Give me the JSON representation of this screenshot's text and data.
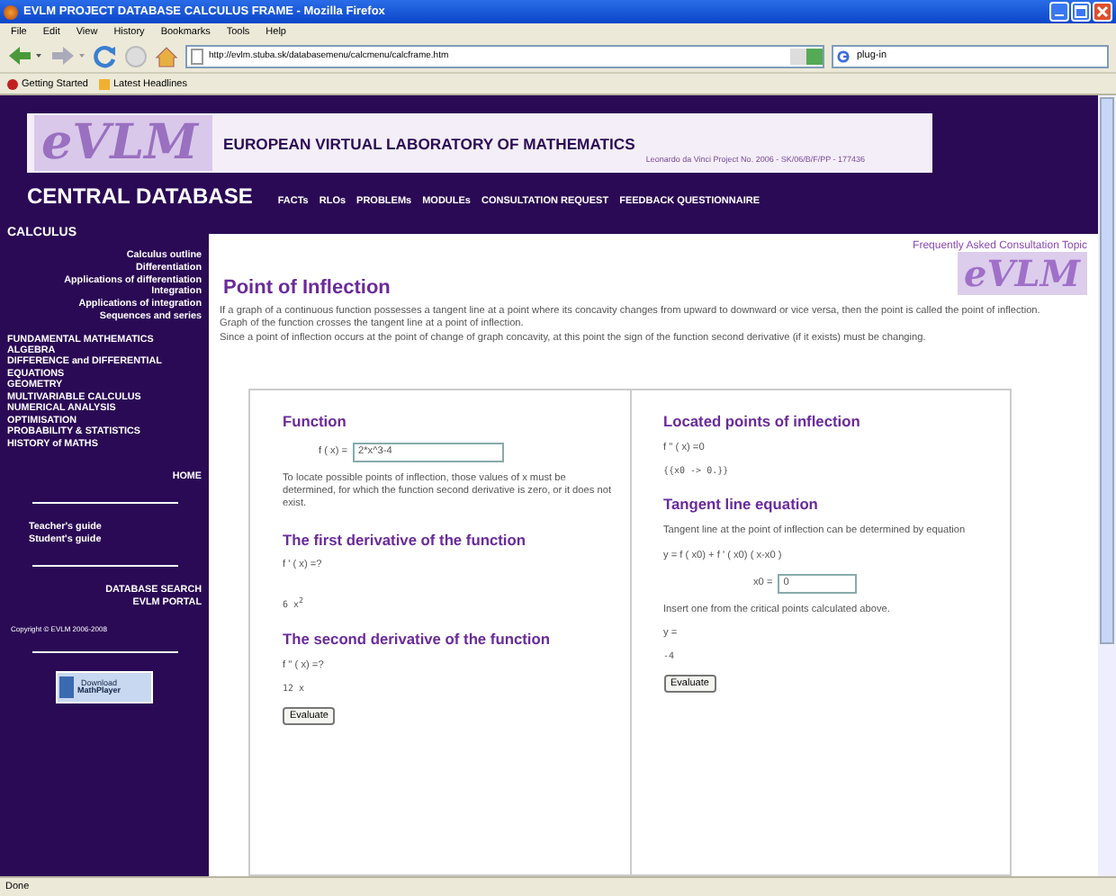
{
  "window": {
    "title": "EVLM PROJECT DATABASE CALCULUS FRAME - Mozilla Firefox"
  },
  "menu": [
    "File",
    "Edit",
    "View",
    "History",
    "Bookmarks",
    "Tools",
    "Help"
  ],
  "address": {
    "value": "http://evlm.stuba.sk/databasemenu/calcmenu/calcframe.htm"
  },
  "search": {
    "value": "plug-in"
  },
  "bookmarks": [
    "Getting Started",
    "Latest Headlines"
  ],
  "header": {
    "logo": "eVLM",
    "title": "EUROPEAN VIRTUAL LABORATORY OF MATHEMATICS",
    "project": "Leonardo da Vinci Project No. 2006 - SK/06/B/F/PP - 177436",
    "site": "CENTRAL DATABASE",
    "nav": [
      "FACTs",
      "RLOs",
      "PROBLEMs",
      "MODULEs",
      "CONSULTATION REQUEST",
      "FEEDBACK QUESTIONNAIRE"
    ]
  },
  "sidebar": {
    "section": "CALCULUS",
    "links": [
      "Calculus outline",
      "Differentiation",
      "Applications of differentiation",
      "Integration",
      "Applications of integration",
      "Sequences and series"
    ],
    "topics": [
      "FUNDAMENTAL MATHEMATICS",
      "ALGEBRA",
      "DIFFERENCE and DIFFERENTIAL EQUATIONS",
      "GEOMETRY",
      "MULTIVARIABLE CALCULUS",
      "NUMERICAL ANALYSIS",
      "OPTIMISATION",
      "PROBABILITY & STATISTICS",
      "HISTORY of MATHS"
    ],
    "home": "HOME",
    "guides": [
      "Teacher's guide",
      "Student's guide"
    ],
    "portal": [
      "DATABASE SEARCH",
      "EVLM PORTAL"
    ],
    "copyright": "Copyright © EVLM 2006-2008",
    "download": [
      "Download",
      "MathPlayer"
    ]
  },
  "content": {
    "faq": "Frequently Asked Consultation Topic",
    "logo": "eVLM",
    "heading": "Point of Inflection",
    "paragraphs": [
      "If a graph of a continuous function possesses a tangent line at a point where its concavity changes from upward to downward or vice versa, then the point is called the point of inflection.",
      "Graph of the function crosses the tangent line at a point of inflection.",
      "Since a point of inflection occurs at the point of change of graph concavity, at this point the sign of the function second derivative (if it exists) must be changing."
    ]
  },
  "left_panel": {
    "function_heading": "Function",
    "function_label": "f ( x) =",
    "function_value": "2*x^3-4",
    "explanation": "To locate possible points of inflection, those values of x must be determined, for which the function second derivative is zero, or it does not exist.",
    "first_heading": "The first derivative of the function",
    "first_label": "f ' ( x) =?",
    "first_result": "6 x$^{2}$",
    "second_heading": "The second derivative of the function",
    "second_label": "f '' ( x) =?",
    "second_result": "12 x",
    "button": "Evaluate"
  },
  "right_panel": {
    "located_heading": "Located points of inflection",
    "located_label": "f '' ( x) =0",
    "located_result": "{{x0 -> 0.}}",
    "tangent_heading": "Tangent line equation",
    "tangent_text": "Tangent line at the point of inflection can be determined by equation",
    "equation": "y = f ( x0) + f ' ( x0) ( x-x0 )",
    "x0_label": "x0 =",
    "x0_value": "0",
    "insert_text": "Insert one from the critical points calculated above.",
    "y_label": "y =",
    "y_result": "-4",
    "button": "Evaluate"
  },
  "status_bar": "Done"
}
